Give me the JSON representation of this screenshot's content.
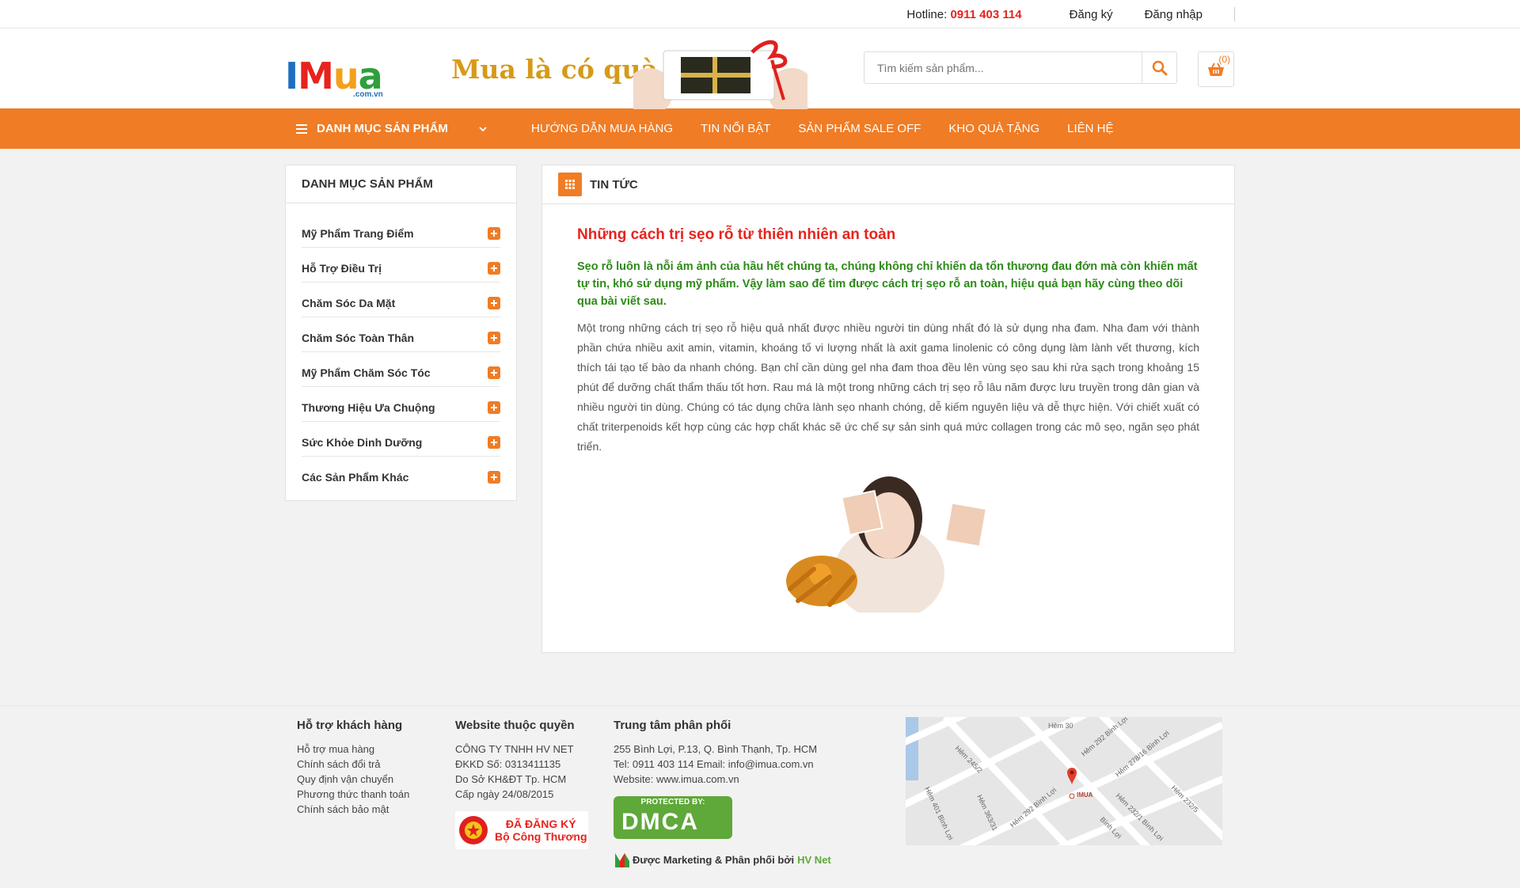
{
  "topbar": {
    "hotline_label": "Hotline:",
    "hotline_number": "0911 403 114",
    "register": "Đăng ký",
    "login": "Đăng nhập"
  },
  "header": {
    "logo": {
      "l1": "I",
      "l2": "M",
      "l3": "u",
      "l4": "a",
      "sub": ".com.vn"
    },
    "banner_text": "Mua là có quà",
    "search_placeholder": "Tìm kiếm sản phẩm...",
    "cart_count": "(0)"
  },
  "nav": {
    "category_label": "DANH MỤC SẢN PHẨM",
    "links": [
      "HƯỚNG DẪN MUA HÀNG",
      "TIN NỔI BẬT",
      "SẢN PHẨM SALE OFF",
      "KHO QUÀ TẶNG",
      "LIÊN HỆ"
    ]
  },
  "sidebar": {
    "title": "DANH MỤC SẢN PHẨM",
    "items": [
      "Mỹ Phẩm Trang Điểm",
      "Hỗ Trợ Điều Trị",
      "Chăm Sóc Da Mặt",
      "Chăm Sóc Toàn Thân",
      "Mỹ Phẩm Chăm Sóc Tóc",
      "Thương Hiệu Ưa Chuộng",
      "Sức Khỏe Dinh Dưỡng",
      "Các Sản Phẩm Khác"
    ]
  },
  "content": {
    "section_title": "TIN TỨC",
    "article_title": "Những cách trị sẹo rỗ từ thiên nhiên an toàn",
    "lead": "Sẹo rỗ luôn là nỗi ám ảnh của hầu hết chúng ta, chúng không chỉ khiến da tổn thương đau đớn mà còn khiến mất tự tin, khó sử dụng mỹ phẩm. Vậy làm sao để tìm được cách trị sẹo rỗ an toàn, hiệu quả bạn hãy cùng theo dõi qua bài viết sau.",
    "body": "Một trong những cách trị sẹo rỗ hiệu quả nhất được nhiều người tin dùng nhất đó là sử dụng nha đam. Nha đam với thành phần chứa nhiều axit amin, vitamin, khoáng tố vi lượng nhất là axit gama linolenic có công dụng làm lành vết thương, kích thích tái tạo tế bào da nhanh chóng. Bạn chỉ cần dùng gel nha đam thoa đều lên vùng sẹo sau khi rửa sạch trong khoảng 15 phút để dưỡng chất thẩm thấu tốt hơn. Rau má là một trong những cách trị sẹo rỗ lâu năm được lưu truyền trong dân gian và nhiều người tin dùng. Chúng có tác dụng chữa lành sẹo nhanh chóng, dễ kiếm nguyên liệu và dễ thực hiện. Với chiết xuất có chất triterpenoids kết hợp cùng các hợp chất khác sẽ ức chế sự sản sinh quá mức collagen trong các mô sẹo, ngăn sẹo phát triển."
  },
  "footer": {
    "support": {
      "title": "Hỗ trợ khách hàng",
      "links": [
        "Hỗ trợ mua hàng",
        "Chính sách đổi trả",
        "Quy định vận chuyển",
        "Phương thức thanh toán",
        "Chính sách bảo mật"
      ]
    },
    "owner": {
      "title": "Website thuộc quyền",
      "lines": [
        "CÔNG TY TNHH HV NET",
        "ĐKKD Số: 0313411135",
        "Do Sở KH&ĐT Tp. HCM",
        "Cấp ngày 24/08/2015"
      ],
      "badge_line1": "ĐÃ ĐĂNG KÝ",
      "badge_line2": "Bộ Công Thương"
    },
    "distribution": {
      "title": "Trung tâm phân phối",
      "lines": [
        "255 Bình Lợi, P.13, Q. Bình Thạnh, Tp. HCM",
        "Tel: 0911 403 114 Email: info@imua.com.vn",
        "Website: www.imua.com.vn"
      ],
      "dmca_top": "PROTECTED BY:",
      "dmca_main": "DMCA",
      "credit_text": "Được Marketing & Phân phối bởi",
      "credit_brand": "HV Net"
    },
    "map": {
      "marker_label": "IMUA",
      "streets": [
        "Hẻm 30",
        "Hẻm 292 Bình Lợi",
        "Hẻm 278/16 Bình Lợi",
        "Hẻm 245/2",
        "Hẻm 401 Bình Lợi",
        "Hẻm 363/31",
        "Hẻm 232/1 Bình Lợi",
        "Hẻm 232/5",
        "Bình Lợi",
        "Hẻm 292 Bình Lợi"
      ]
    }
  },
  "colors": {
    "accent": "#f07c25",
    "headline": "#e8231d",
    "lead": "#2d8a18",
    "logo_blue": "#1d6fc0",
    "dmca_green": "#5fa83a"
  }
}
